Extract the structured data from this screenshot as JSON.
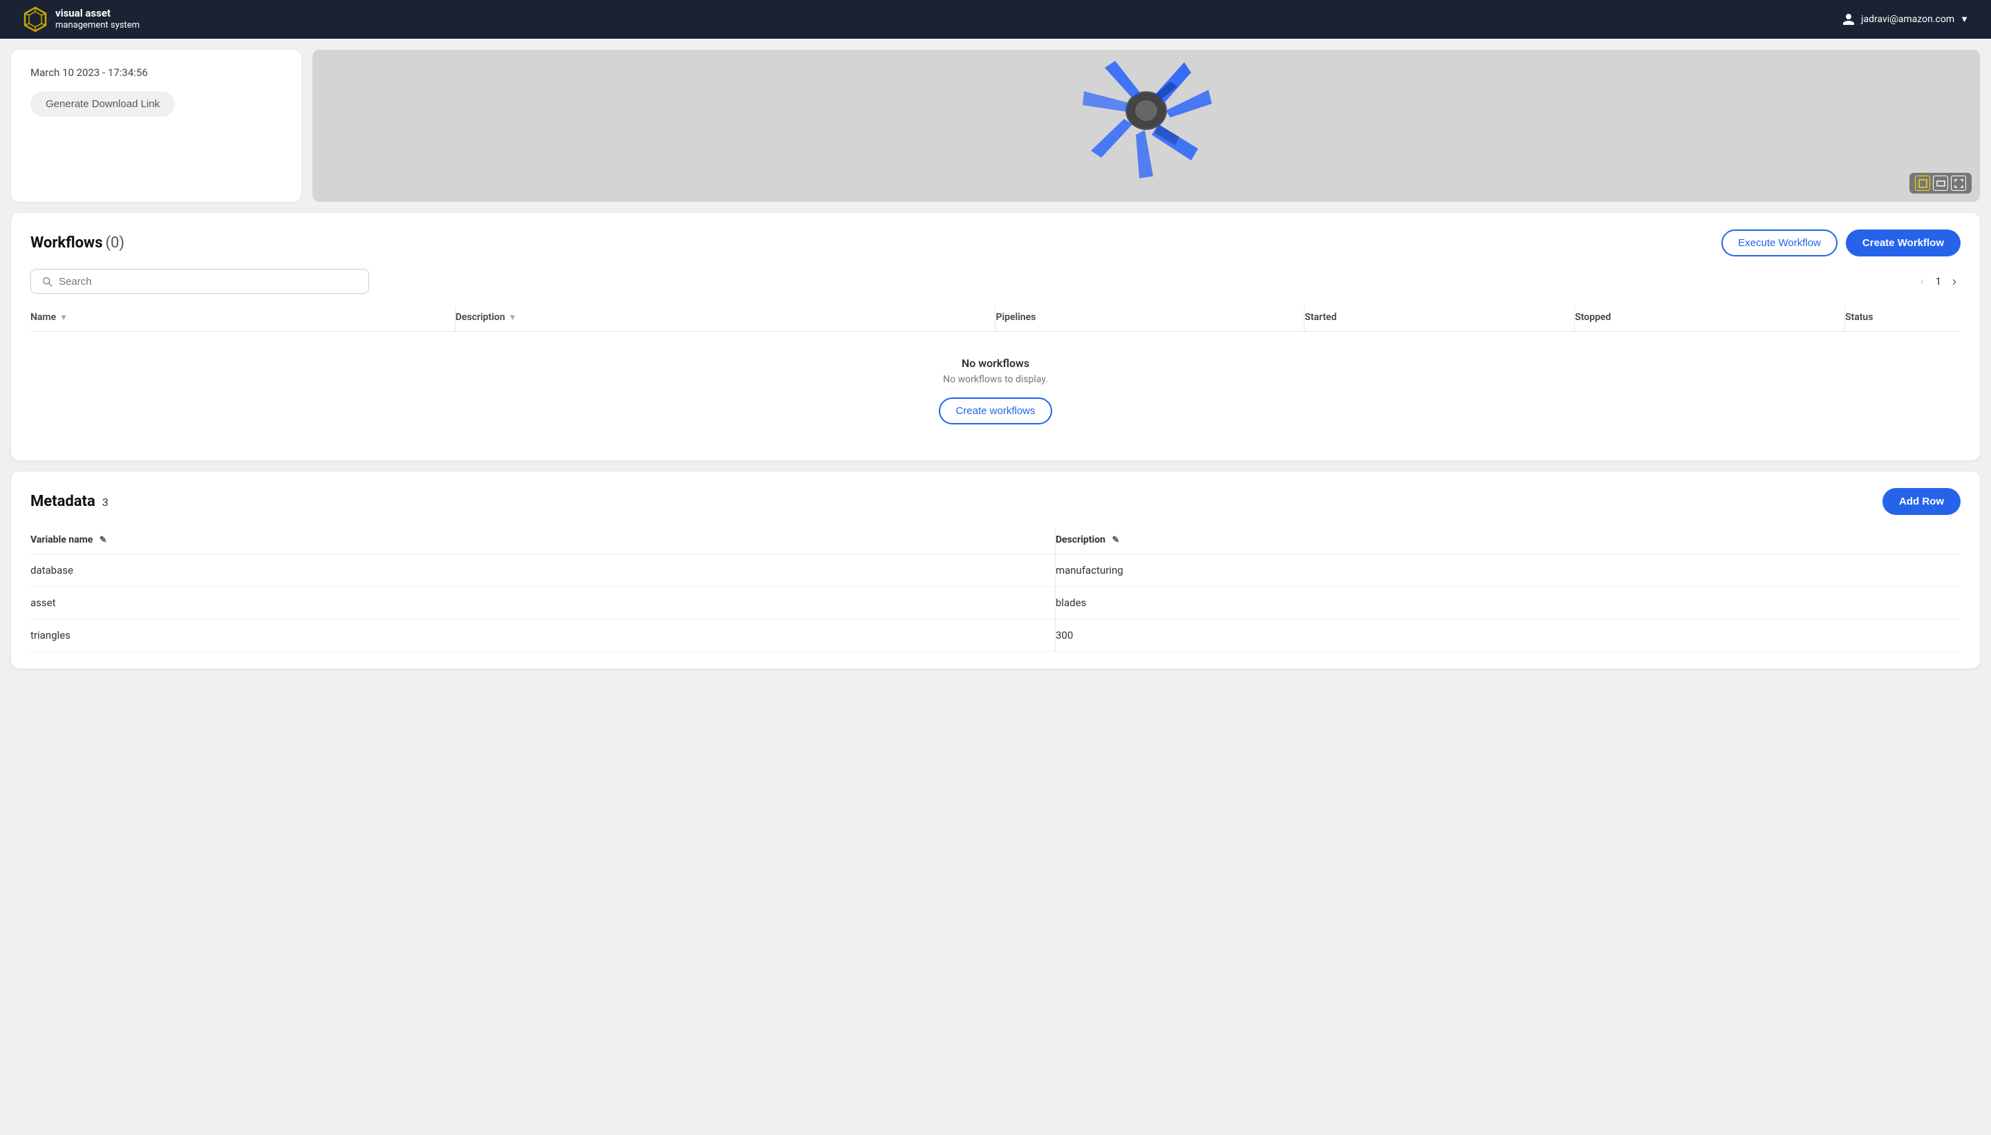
{
  "app": {
    "name": "visual asset",
    "subtitle": "management system",
    "user_email": "jadravi@amazon.com"
  },
  "top_card": {
    "date": "March 10 2023 - 17:34:56",
    "generate_btn_label": "Generate Download Link"
  },
  "workflows": {
    "title": "Workflows",
    "count": "(0)",
    "execute_btn": "Execute Workflow",
    "create_btn": "Create Workflow",
    "search_placeholder": "Search",
    "page_current": "1",
    "columns": {
      "name": "Name",
      "description": "Description",
      "pipelines": "Pipelines",
      "started": "Started",
      "stopped": "Stopped",
      "status": "Status"
    },
    "empty": {
      "title": "No workflows",
      "subtitle": "No workflows to display.",
      "create_label": "Create workflows"
    }
  },
  "metadata": {
    "title": "Metadata",
    "count": "3",
    "add_row_btn": "Add Row",
    "columns": {
      "variable_name": "Variable name",
      "description": "Description"
    },
    "rows": [
      {
        "variable_name": "database",
        "description": "manufacturing"
      },
      {
        "variable_name": "asset",
        "description": "blades"
      },
      {
        "variable_name": "triangles",
        "description": "300"
      }
    ]
  },
  "preview_controls": {
    "ctrl1": "⬜",
    "ctrl2": "▭",
    "ctrl3": "⛶"
  }
}
